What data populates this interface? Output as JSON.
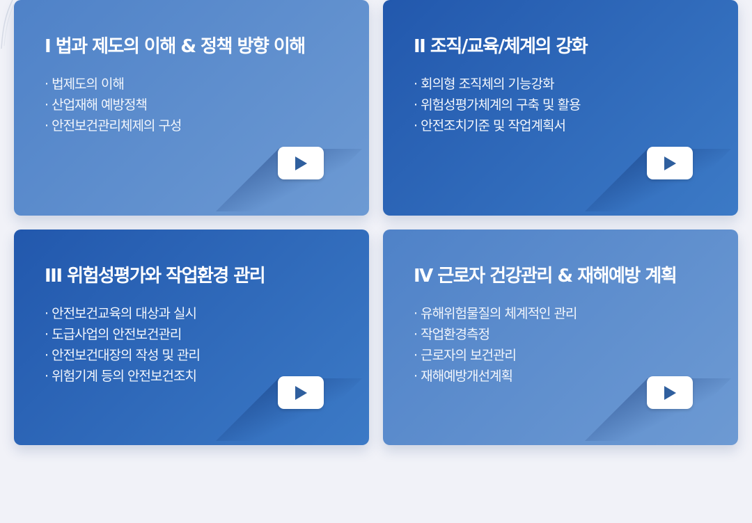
{
  "cards": [
    {
      "title": "I 법과 제도의 이해 & 정책 방향 이해",
      "items": [
        "법제도의 이해",
        "산업재해 예방정책",
        "안전보건관리체제의 구성"
      ]
    },
    {
      "title": "II 조직/교육/체계의 강화",
      "items": [
        "회의형 조직체의 기능강화",
        "위험성평가체계의 구축 및 활용",
        "안전조치기준 및 작업계획서"
      ]
    },
    {
      "title": "III 위험성평가와 작업환경 관리",
      "items": [
        "안전보건교육의 대상과 실시",
        "도급사업의 안전보건관리",
        "안전보건대장의 작성 및 관리",
        "위험기계 등의 안전보건조치"
      ]
    },
    {
      "title": "IV 근로자 건강관리 & 재해예방 계획",
      "items": [
        "유해위험물질의 체계적인 관리",
        "작업환경측정",
        "근로자의 보건관리",
        "재해예방개선계획"
      ]
    }
  ],
  "icons": {
    "play": "play-icon"
  },
  "colors": {
    "card_light": "#5f8fce",
    "card_dark": "#2e69b8",
    "play_arrow": "#2f5f9e",
    "background": "#f1f2f8"
  }
}
